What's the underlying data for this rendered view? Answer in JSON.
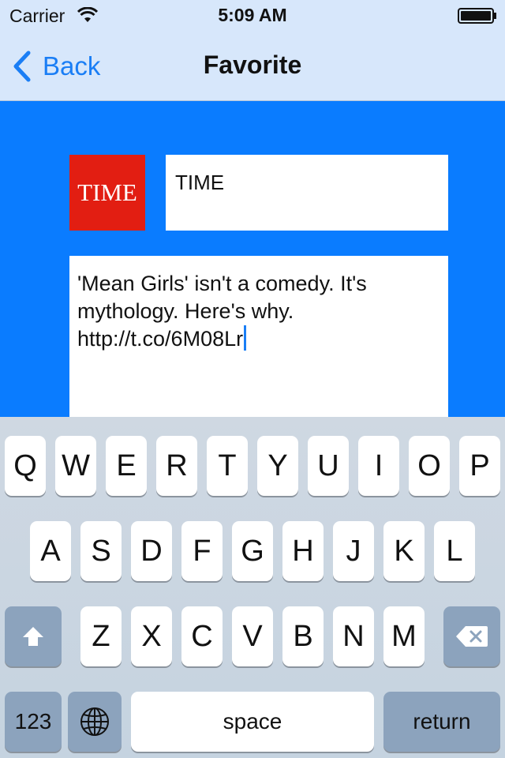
{
  "status_bar": {
    "carrier": "Carrier",
    "time": "5:09 AM"
  },
  "nav": {
    "back_label": "Back",
    "title": "Favorite"
  },
  "profile": {
    "logo_text": "TIME",
    "name": "TIME"
  },
  "tweet": {
    "text": "'Mean Girls' isn't a comedy. It's mythology. Here's why. http://t.co/6M08Lr"
  },
  "keyboard": {
    "row1": [
      "Q",
      "W",
      "E",
      "R",
      "T",
      "Y",
      "U",
      "I",
      "O",
      "P"
    ],
    "row2": [
      "A",
      "S",
      "D",
      "F",
      "G",
      "H",
      "J",
      "K",
      "L"
    ],
    "row3": [
      "Z",
      "X",
      "C",
      "V",
      "B",
      "N",
      "M"
    ],
    "numbers_label": "123",
    "space_label": "space",
    "return_label": "return"
  },
  "colors": {
    "accent": "#1a7ef5",
    "background": "#0a7cff",
    "logo_red": "#e21e12",
    "nav_bar": "#d7e7fb"
  }
}
